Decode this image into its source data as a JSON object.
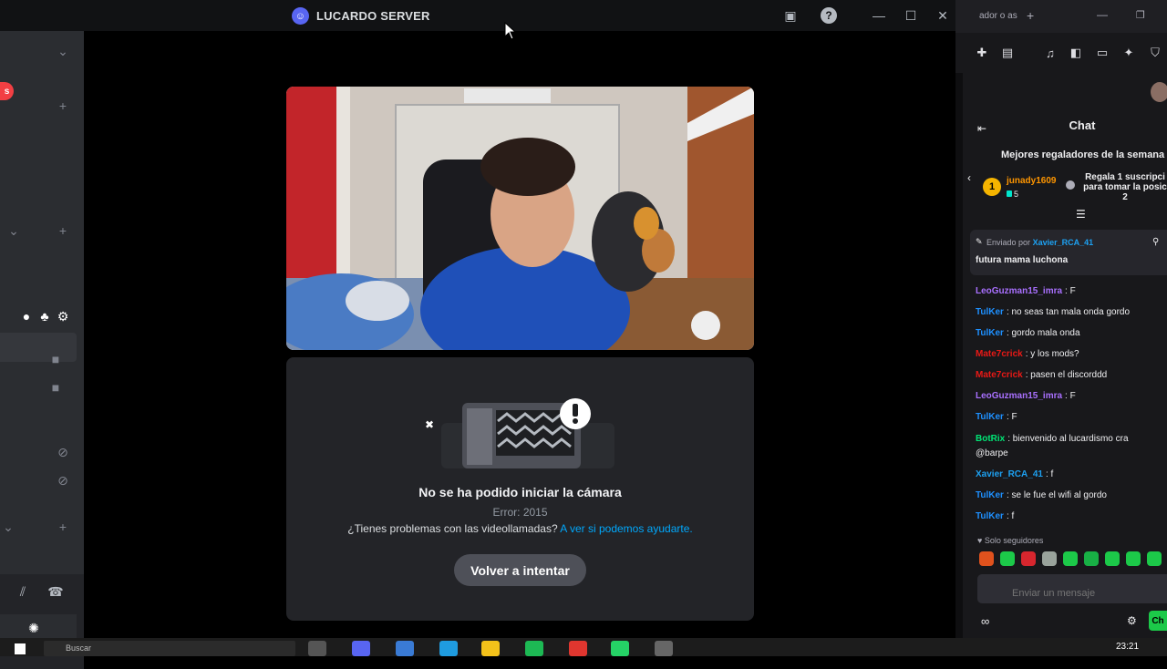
{
  "titlebar": {
    "server_name": "LUCARDO SERVER",
    "browser_tab_text": "ador o as"
  },
  "camera_error": {
    "title": "No se ha podido iniciar la cámara",
    "error_code": "Error: 2015",
    "help_text": "¿Tienes problemas con las videollamadas?",
    "help_link": "A ver si podemos ayudarte.",
    "retry_label": "Volver a intentar"
  },
  "chat": {
    "header": "Chat",
    "top_gifters_title": "Mejores regaladores de la semana",
    "gifter_rank": "1",
    "gifter_name": "junady1609",
    "gifter_count": "5",
    "gift_cta_line1": "Regala 1 suscripci",
    "gift_cta_line2": "para tomar la posic",
    "gift_cta_line3": "2",
    "pinned_by_label": "Enviado por",
    "pinned_by_user": "Xavier_RCA_41",
    "pinned_message": "futura mama luchona",
    "messages": [
      {
        "user": "LeoGuzman15_imra",
        "text": ": F",
        "color": "#a970ff"
      },
      {
        "user": "TulKer",
        "text": ": no seas tan mala onda gordo",
        "color": "#1e90ff"
      },
      {
        "user": "TulKer",
        "text": ": gordo mala onda",
        "color": "#1e90ff"
      },
      {
        "user": "Mate7crick",
        "text": ": y los mods?",
        "color": "#e91916"
      },
      {
        "user": "Mate7crick",
        "text": ": pasen el discorddd",
        "color": "#e91916"
      },
      {
        "user": "LeoGuzman15_imra",
        "text": ": F",
        "color": "#a970ff"
      },
      {
        "user": "TulKer",
        "text": ": F",
        "color": "#1e90ff"
      },
      {
        "user": "BotRix",
        "text": ": bienvenido al lucardismo cra",
        "color": "#00e676"
      },
      {
        "user": "",
        "text": "@barpe",
        "color": "#efeff1"
      },
      {
        "user": "Xavier_RCA_41",
        "text": ": f",
        "color": "#1da1f2"
      },
      {
        "user": "TulKer",
        "text": ": se le fue el wifi al gordo",
        "color": "#1e90ff"
      },
      {
        "user": "TulKer",
        "text": ": f",
        "color": "#1e90ff"
      }
    ],
    "followers_only": "Solo seguidores",
    "input_placeholder": "Enviar un mensaje",
    "send_label": "Ch"
  },
  "taskbar": {
    "search_placeholder": "Buscar",
    "clock": "23:21"
  },
  "colors": {
    "discord_bg": "#2b2d31",
    "twitch_bg": "#18181b",
    "link": "#00a8fc"
  }
}
